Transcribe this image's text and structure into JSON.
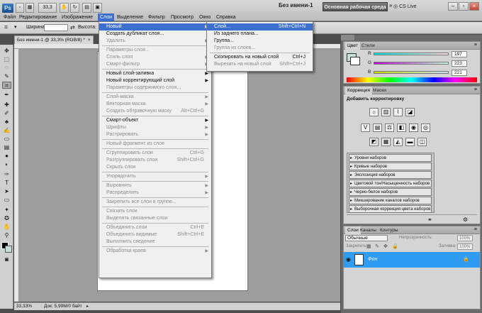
{
  "app": {
    "logo": "Ps",
    "zoom": "33,3",
    "doc_title": "Без имени-1",
    "workspace": "Основная рабочая среда",
    "cslive": "CS Live"
  },
  "menubar": [
    "Файл",
    "Редактирование",
    "Изображение",
    "Слои",
    "Выделение",
    "Фильтр",
    "Просмотр",
    "Окно",
    "Справка"
  ],
  "options": {
    "width_label": "Ширина:",
    "height_label": "Высота:"
  },
  "document": {
    "tab_title": "Без имени-1 @ 33,3% (RGB/8) *"
  },
  "status": {
    "zoom": "33,33%",
    "doc_info": "Док: 5,99M/0 байт"
  },
  "layers_menu": [
    {
      "label": "Новый",
      "arrow": true,
      "highlight": true
    },
    {
      "label": "Создать дубликат слоя..."
    },
    {
      "label": "Удалить",
      "arrow": true,
      "disabled": true
    },
    {
      "sep": true
    },
    {
      "label": "Параметры слоя...",
      "disabled": true
    },
    {
      "label": "Стиль слоя",
      "arrow": true,
      "disabled": true
    },
    {
      "label": "Смарт-фильтр",
      "arrow": true,
      "disabled": true
    },
    {
      "sep": true
    },
    {
      "label": "Новый слой-заливка",
      "arrow": true
    },
    {
      "label": "Новый корректирующий слой",
      "arrow": true
    },
    {
      "label": "Параметры содержимого слоя...",
      "disabled": true
    },
    {
      "sep": true
    },
    {
      "label": "Слой-маска",
      "arrow": true,
      "disabled": true
    },
    {
      "label": "Векторная маска",
      "arrow": true,
      "disabled": true
    },
    {
      "label": "Создать обтравочную маску",
      "shortcut": "Alt+Ctrl+G",
      "disabled": true
    },
    {
      "sep": true
    },
    {
      "label": "Смарт-объект",
      "arrow": true
    },
    {
      "label": "Шрифты",
      "arrow": true,
      "disabled": true
    },
    {
      "label": "Растрировать",
      "arrow": true,
      "disabled": true
    },
    {
      "sep": true
    },
    {
      "label": "Новый фрагмент из слоя",
      "disabled": true
    },
    {
      "sep": true
    },
    {
      "label": "Сгруппировать слои",
      "shortcut": "Ctrl+G",
      "disabled": true
    },
    {
      "label": "Разгруппировать слои",
      "shortcut": "Shift+Ctrl+G",
      "disabled": true
    },
    {
      "label": "Скрыть слои",
      "disabled": true
    },
    {
      "sep": true
    },
    {
      "label": "Упорядочить",
      "arrow": true,
      "disabled": true
    },
    {
      "sep": true
    },
    {
      "label": "Выровнять",
      "arrow": true,
      "disabled": true
    },
    {
      "label": "Распределить",
      "arrow": true,
      "disabled": true
    },
    {
      "sep": true
    },
    {
      "label": "Закрепить все слои в группе...",
      "disabled": true
    },
    {
      "sep": true
    },
    {
      "label": "Связать слои",
      "disabled": true
    },
    {
      "label": "Выделить связанные слои",
      "disabled": true
    },
    {
      "sep": true
    },
    {
      "label": "Объединить слои",
      "shortcut": "Ctrl+E",
      "disabled": true
    },
    {
      "label": "Объединить видимые",
      "shortcut": "Shift+Ctrl+E",
      "disabled": true
    },
    {
      "label": "Выполнить сведение",
      "disabled": true
    },
    {
      "sep": true
    },
    {
      "label": "Обработка краев",
      "arrow": true,
      "disabled": true
    }
  ],
  "new_submenu": [
    {
      "label": "Слой...",
      "shortcut": "Shift+Ctrl+N",
      "highlight": true
    },
    {
      "label": "Из заднего плана..."
    },
    {
      "label": "Группа..."
    },
    {
      "label": "Группа из слоев...",
      "disabled": true
    },
    {
      "sep": true
    },
    {
      "label": "Скопировать на новый слой",
      "shortcut": "Ctrl+J"
    },
    {
      "label": "Вырезать на новый слой",
      "shortcut": "Shift+Ctrl+J",
      "disabled": true
    }
  ],
  "color_panel": {
    "tabs": [
      "Цвет",
      "Стили"
    ],
    "channels": [
      {
        "name": "R",
        "value": "197"
      },
      {
        "name": "G",
        "value": "223"
      },
      {
        "name": "B",
        "value": "221"
      }
    ],
    "swatch": "#c5dfdd"
  },
  "adjust_panel": {
    "tabs": [
      "Коррекция",
      "Маски"
    ],
    "title": "Добавить корректировку",
    "presets": [
      "Уровни наборов",
      "Кривые наборов",
      "Экспозиция наборов",
      "Цветовой тон/Насыщенность наборов",
      "Черно-белое наборов",
      "Микширование каналов наборов",
      "Выборочная коррекция цвета наборов"
    ]
  },
  "layers_panel": {
    "tabs": [
      "Слои",
      "Каналы",
      "Контуры"
    ],
    "blend_mode": "Обычные",
    "opacity_label": "Непрозрачность:",
    "opacity": "100%",
    "lock_label": "Закрепить:",
    "fill_label": "Заливка:",
    "fill": "100%",
    "layer_name": "Фон"
  },
  "colors": {
    "accent": "#3c6fcf",
    "layer_selected": "#2f9cf2"
  }
}
